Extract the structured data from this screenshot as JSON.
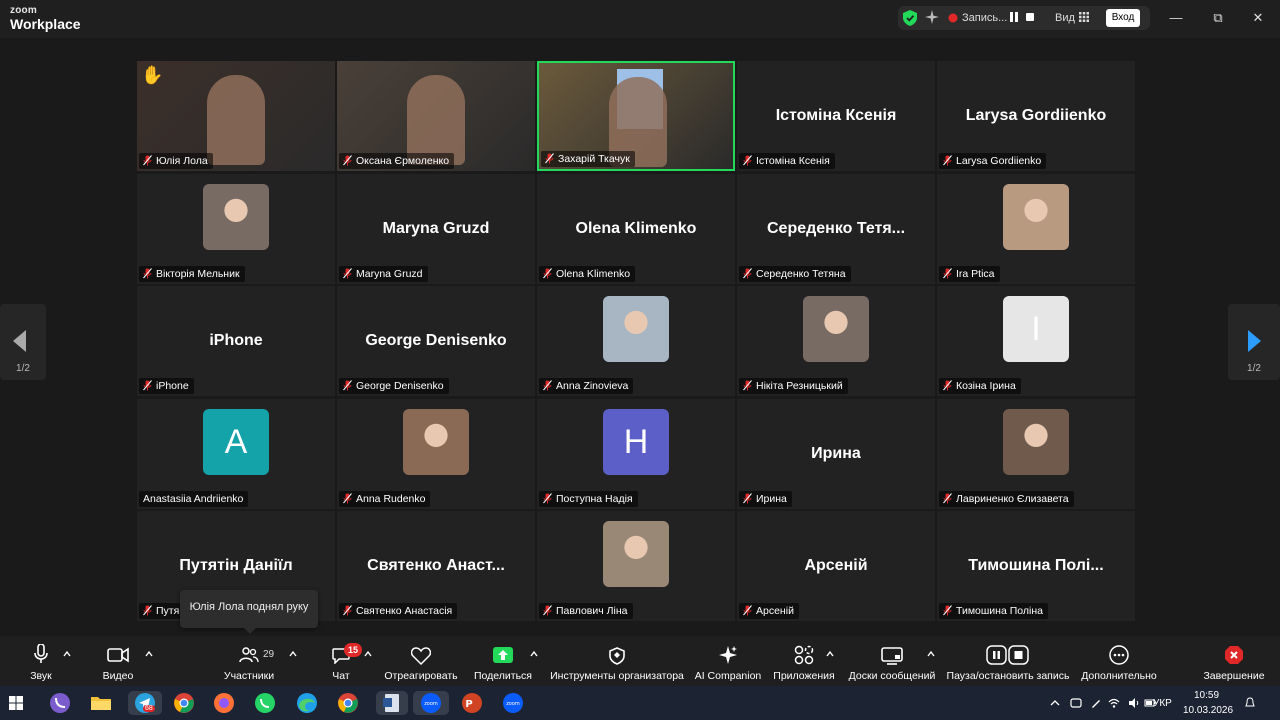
{
  "app": {
    "logo_line1": "zoom",
    "logo_line2": "Workplace"
  },
  "titlebar": {
    "recording_label": "Запись...",
    "view_label": "Вид",
    "login_label": "Вход"
  },
  "pagination": {
    "left": "1/2",
    "right": "1/2"
  },
  "participants": [
    {
      "name": "Юлія Лола",
      "display": "",
      "kind": "video",
      "hand": true
    },
    {
      "name": "Оксана Єрмоленко",
      "display": "",
      "kind": "video"
    },
    {
      "name": "Захарій Ткачук",
      "display": "",
      "kind": "video",
      "active": true
    },
    {
      "name": "Істоміна Ксенія",
      "display": "Істоміна Ксенія",
      "kind": "name"
    },
    {
      "name": "Larysa Gordiienko",
      "display": "Larysa Gordiienko",
      "kind": "name"
    },
    {
      "name": "Вікторія Мельник",
      "display": "",
      "kind": "photo"
    },
    {
      "name": "Maryna Gruzd",
      "display": "Maryna Gruzd",
      "kind": "name"
    },
    {
      "name": "Olena Klimenko",
      "display": "Olena Klimenko",
      "kind": "name"
    },
    {
      "name": "Середенко Тетяна",
      "display": "Середенко  Тетя...",
      "kind": "name"
    },
    {
      "name": "Ira Ptica",
      "display": "",
      "kind": "photo"
    },
    {
      "name": "iPhone",
      "display": "iPhone",
      "kind": "name"
    },
    {
      "name": "George Denisenko",
      "display": "George Denisenko",
      "kind": "name"
    },
    {
      "name": "Anna Zinovieva",
      "display": "",
      "kind": "photo"
    },
    {
      "name": "Нікіта Резницький",
      "display": "",
      "kind": "photo"
    },
    {
      "name": "Козіна Ірина",
      "display": "",
      "kind": "letter",
      "letter": "I",
      "color": "#e6e6e6",
      "letter_color": "#ffffff"
    },
    {
      "name": "Anastasiia Andriienko",
      "display": "",
      "kind": "letter",
      "letter": "A",
      "color": "#13a3a8",
      "letter_color": "#ffffff",
      "unmuted": true
    },
    {
      "name": "Anna Rudenko",
      "display": "",
      "kind": "photo"
    },
    {
      "name": "Поступна Надія",
      "display": "",
      "kind": "letter",
      "letter": "H",
      "color": "#5b5fc7",
      "letter_color": "#ffffff"
    },
    {
      "name": "Ирина",
      "display": "Ирина",
      "kind": "name"
    },
    {
      "name": "Лавриненко Єлизавета",
      "display": "",
      "kind": "photo"
    },
    {
      "name": "Путятін Даніїл",
      "tag": "Путя",
      "display": "Путятін Даніїл",
      "kind": "name"
    },
    {
      "name": "Святенко Анастасія",
      "display": "Святенко  Анаст...",
      "kind": "name"
    },
    {
      "name": "Павлович Ліна",
      "display": "",
      "kind": "photo"
    },
    {
      "name": "Арсеній",
      "display": "Арсеній",
      "kind": "name"
    },
    {
      "name": "Тимошина Поліна",
      "display": "Тимошина  Полі...",
      "kind": "name"
    }
  ],
  "tooltip": "Юлія Лола поднял руку",
  "toolbar": {
    "audio": "Звук",
    "video": "Видео",
    "participants": "Участники",
    "participants_count": "29",
    "chat": "Чат",
    "chat_badge": "15",
    "react": "Отреагировать",
    "share": "Поделиться",
    "host_tools": "Инструменты организатора",
    "ai": "AI Companion",
    "apps": "Приложения",
    "whiteboards": "Доски сообщений",
    "pause_rec": "Пауза/остановить запись",
    "more": "Дополнительно",
    "end": "Завершение"
  },
  "taskbar": {
    "telegram_badge": "68",
    "lang": "УКР",
    "time": "10:59",
    "date": "10.03.2026"
  },
  "colors": {
    "active_speaker": "#23d959",
    "end_red": "#e02828",
    "share_green": "#23d959",
    "next_arrow": "#2d9cff"
  }
}
